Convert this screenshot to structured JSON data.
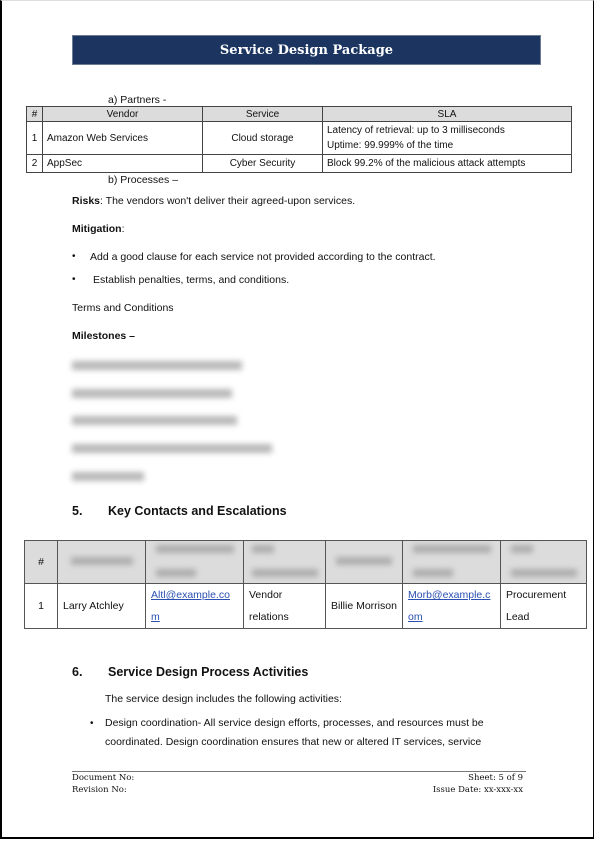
{
  "header": {
    "title": "Service Design Package"
  },
  "partners": {
    "label": "a)   Partners -",
    "table": {
      "headers": [
        "#",
        "Vendor",
        "Service",
        "SLA"
      ],
      "rows": [
        {
          "num": "1",
          "vendor": "Amazon Web Services",
          "service": "Cloud storage",
          "sla": [
            "Latency of retrieval: up to 3 milliseconds",
            "Uptime: 99.999% of the time"
          ]
        },
        {
          "num": "2",
          "vendor": "AppSec",
          "service": "Cyber Security",
          "sla": [
            "Block 99.2% of the malicious attack attempts"
          ]
        }
      ]
    }
  },
  "processes": {
    "label": "b) Processes –",
    "risks_label": "Risks",
    "risks_text": ": The vendors won't deliver their agreed-upon services.",
    "mitigation_label": "Mitigation",
    "mitigation_suffix": ":",
    "mitigation_items": [
      "Add a good clause for each service not provided according to the contract.",
      "Establish penalties, terms, and conditions."
    ],
    "terms_label": "Terms and Conditions",
    "milestones_label": "Milestones –",
    "milestones_redacted_count": 5
  },
  "section5": {
    "number": "5.",
    "title": "Key Contacts and Escalations",
    "table": {
      "headers": [
        "#"
      ],
      "headers_redacted": true,
      "rows": [
        {
          "num": "1",
          "name1": "Larry Atchley",
          "email1": "Altl@example.com",
          "role1": "Vendor relations",
          "name2": "Billie Morrison",
          "email2": "Morb@example.com",
          "role2": "Procurement Lead"
        }
      ]
    }
  },
  "section6": {
    "number": "6.",
    "title": "Service Design Process Activities",
    "intro": "The service design includes the following activities:",
    "items": [
      "Design coordination- All service design efforts, processes, and resources must be coordinated. Design coordination ensures that new or altered IT services, service"
    ]
  },
  "footer": {
    "document_no_label": "Document No:",
    "revision_no_label": "Revision No:",
    "sheet": "Sheet: 5 of 9",
    "issue_date": "Issue Date: xx-xxx-xx"
  },
  "colors": {
    "title_bar": "#1c3560",
    "table_header": "#dcdcdc",
    "link": "#2a4fb0"
  }
}
